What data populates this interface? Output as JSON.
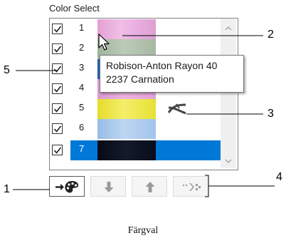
{
  "panel": {
    "title": "Color Select"
  },
  "rows": [
    {
      "number": "1",
      "checked": true,
      "color": "#e8a8d8",
      "selected": false
    },
    {
      "number": "2",
      "checked": true,
      "color": "#a8bca4",
      "selected": false
    },
    {
      "number": "3",
      "checked": true,
      "color": "#2f72c4",
      "selected": false
    },
    {
      "number": "4",
      "checked": true,
      "color": "#e2a0d6",
      "selected": false
    },
    {
      "number": "5",
      "checked": true,
      "color": "#ece438",
      "selected": false
    },
    {
      "number": "6",
      "checked": true,
      "color": "#a4c4ea",
      "selected": false
    },
    {
      "number": "7",
      "checked": true,
      "color": "#0a0e1c",
      "selected": true
    }
  ],
  "tooltip": {
    "line1": "Robison-Anton Rayon 40",
    "line2": "2237  Carnation"
  },
  "toolbar": {
    "buttons": [
      {
        "icon": "assign-color-icon",
        "enabled": true
      },
      {
        "icon": "arrow-down-icon",
        "enabled": false
      },
      {
        "icon": "arrow-up-icon",
        "enabled": false
      },
      {
        "icon": "jump-stitch-icon",
        "enabled": false
      }
    ]
  },
  "callouts": {
    "c1": "1",
    "c2": "2",
    "c3": "3",
    "c4": "4",
    "c5": "5"
  },
  "caption": "Färgval",
  "colors": {
    "selection": "#0078d7",
    "icon_active": "#222222",
    "icon_disabled": "#9a9a9a"
  }
}
